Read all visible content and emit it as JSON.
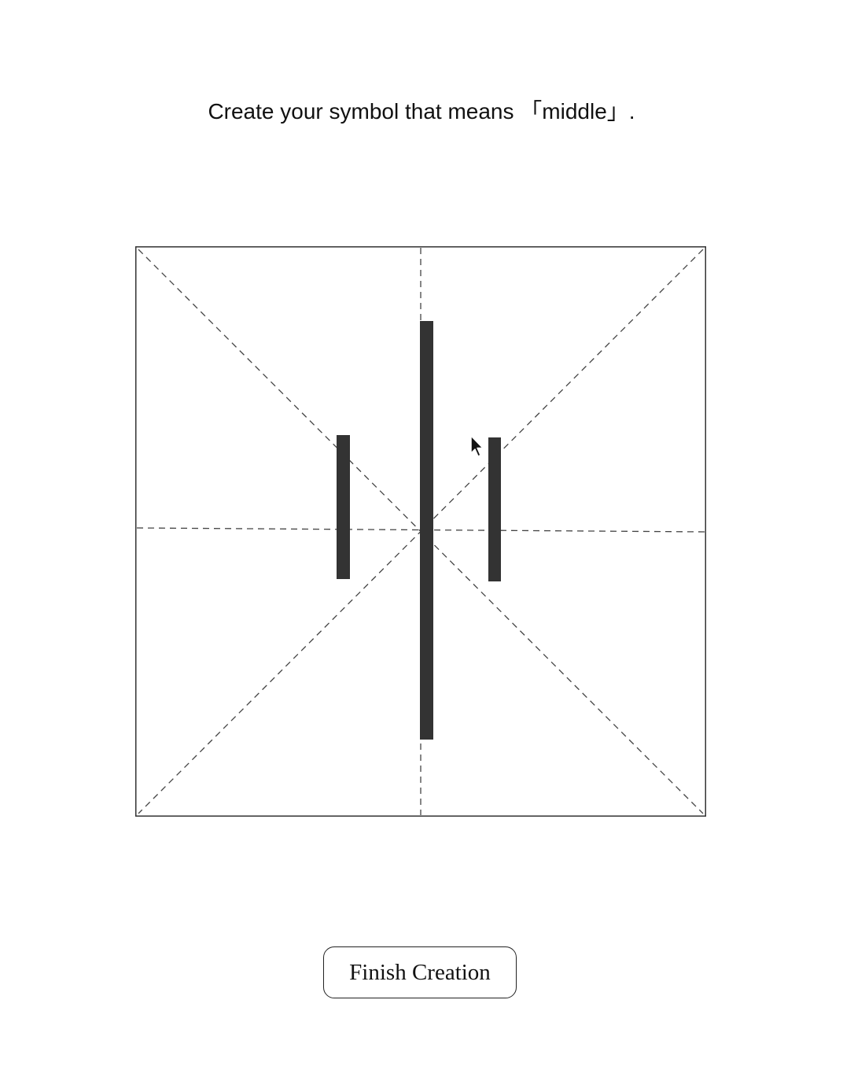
{
  "prompt": {
    "text": "Create your symbol that means 「middle」."
  },
  "canvas": {
    "border_color": "#333333",
    "guide_color": "#444444",
    "stroke_color": "#333333"
  },
  "actions": {
    "finish_label": "Finish Creation"
  },
  "icons": {
    "cursor": "mouse-pointer-icon"
  }
}
